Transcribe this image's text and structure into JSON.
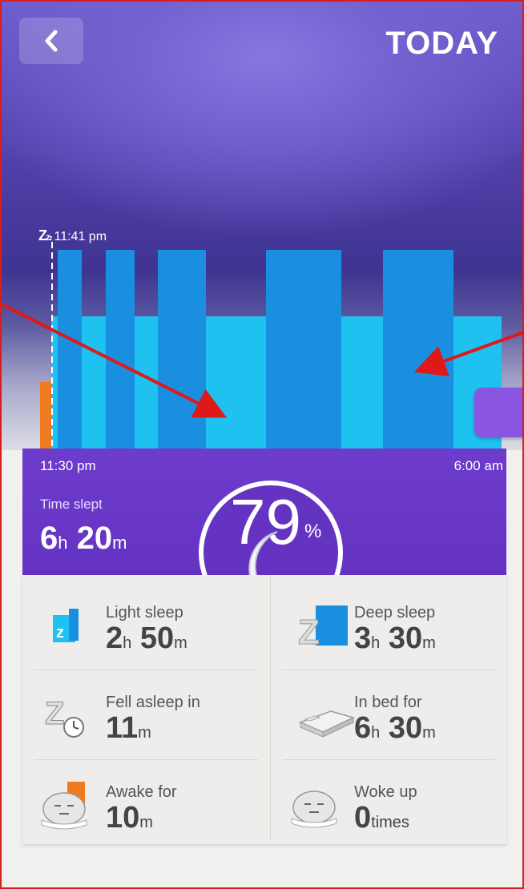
{
  "header": {
    "title": "TODAY",
    "back_icon": "chevron-left-icon"
  },
  "chart": {
    "sleep_start_label": "11:41 pm",
    "range_start": "11:30 pm",
    "range_end": "6:00 am",
    "colors": {
      "light": "#1ec1f0",
      "deep": "#1a8fe0",
      "awake": "#f07a20",
      "mark": "#ffffff"
    },
    "moon_icon": "moon-icon"
  },
  "summary": {
    "time_slept_label": "Time slept",
    "time_slept_hours": "6",
    "time_slept_minutes": "20",
    "score": "79",
    "score_unit": "%"
  },
  "stats": [
    {
      "label": "Light sleep",
      "value_main": "2",
      "unit1": "h",
      "value_second": "50",
      "unit2": "m",
      "icon": "light-sleep-icon"
    },
    {
      "label": "Deep sleep",
      "value_main": "3",
      "unit1": "h",
      "value_second": "30",
      "unit2": "m",
      "icon": "deep-sleep-icon"
    },
    {
      "label": "Fell asleep in",
      "value_main": "11",
      "unit1": "m",
      "value_second": "",
      "unit2": "",
      "icon": "fell-asleep-icon"
    },
    {
      "label": "In bed for",
      "value_main": "6",
      "unit1": "h",
      "value_second": "30",
      "unit2": "m",
      "icon": "bed-icon"
    },
    {
      "label": "Awake for",
      "value_main": "10",
      "unit1": "m",
      "value_second": "",
      "unit2": "",
      "icon": "awake-face-icon"
    },
    {
      "label": "Woke up",
      "value_main": "0",
      "unit1": "times",
      "value_second": "",
      "unit2": "",
      "icon": "woke-up-face-icon"
    }
  ]
}
